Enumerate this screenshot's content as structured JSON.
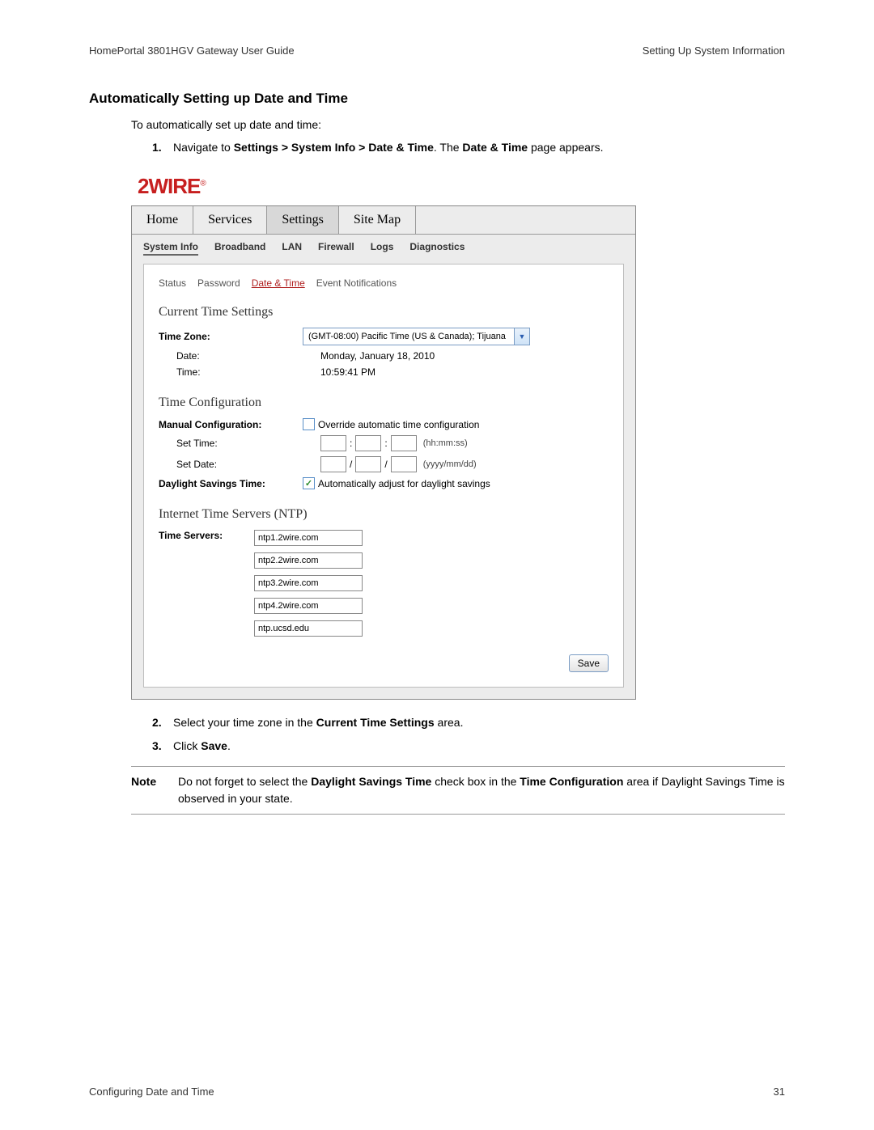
{
  "header": {
    "left": "HomePortal 3801HGV Gateway User Guide",
    "right": "Setting Up System Information"
  },
  "title": "Automatically Setting up Date and Time",
  "intro": "To automatically set up date and time:",
  "step1": {
    "num": "1.",
    "pre": "Navigate to ",
    "path": "Settings > System Info > Date & Time",
    "mid": ". The ",
    "page": "Date & Time",
    "post": " page appears."
  },
  "ui": {
    "logo": "2WIRE",
    "main_tabs": [
      "Home",
      "Services",
      "Settings",
      "Site Map"
    ],
    "main_active": 2,
    "sub_tabs": [
      "System Info",
      "Broadband",
      "LAN",
      "Firewall",
      "Logs",
      "Diagnostics"
    ],
    "sub_active": 0,
    "tertiary": [
      "Status",
      "Password",
      "Date & Time",
      "Event Notifications"
    ],
    "tertiary_active": 2,
    "current_heading": "Current Time Settings",
    "tz_label": "Time Zone:",
    "tz_value": "(GMT-08:00) Pacific Time (US & Canada); Tijuana",
    "date_label": "Date:",
    "date_value": "Monday, January 18, 2010",
    "time_label": "Time:",
    "time_value": "10:59:41 PM",
    "config_heading": "Time Configuration",
    "manual_label": "Manual Configuration:",
    "override_text": "Override automatic time configuration",
    "set_time_label": "Set Time:",
    "set_time_hint": "(hh:mm:ss)",
    "set_date_label": "Set Date:",
    "set_date_hint": "(yyyy/mm/dd)",
    "dst_label": "Daylight Savings Time:",
    "dst_text": "Automatically adjust for daylight savings",
    "ntp_heading": "Internet Time Servers (NTP)",
    "ntp_label": "Time Servers:",
    "ntp_servers": [
      "ntp1.2wire.com",
      "ntp2.2wire.com",
      "ntp3.2wire.com",
      "ntp4.2wire.com",
      "ntp.ucsd.edu"
    ],
    "save": "Save",
    "colon": ":",
    "slash": "/"
  },
  "step2": {
    "num": "2.",
    "pre": "Select your time zone in the ",
    "bold": "Current Time Settings",
    "post": " area."
  },
  "step3": {
    "num": "3.",
    "pre": "Click ",
    "bold": "Save",
    "post": "."
  },
  "note": {
    "label": "Note",
    "pre": "Do not forget to select the ",
    "b1": "Daylight Savings Time",
    "mid": " check box in the ",
    "b2": "Time Configuration",
    "post": " area if Daylight Savings Time is observed in your state."
  },
  "footer": {
    "left": "Configuring Date and Time",
    "right": "31"
  }
}
